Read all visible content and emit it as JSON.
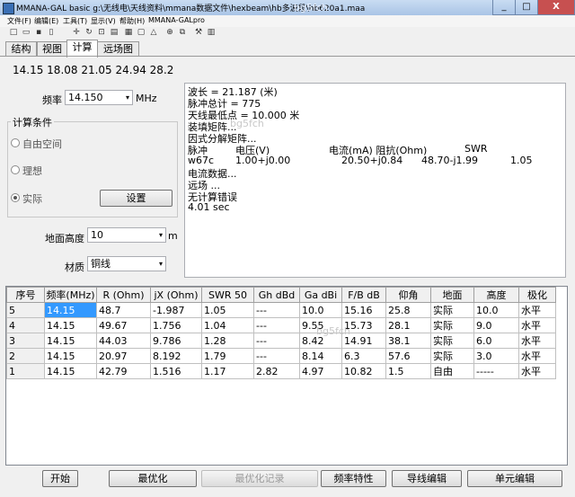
{
  "window": {
    "title": "MMANA-GAL basic g:\\无线电\\天线资料\\mmana数据文件\\hexbeam\\hb多波段\\hb620a1.maa",
    "watermark": "bg5fch",
    "min": "_",
    "max": "□",
    "close": "X"
  },
  "menu": [
    "文件(F)",
    "编辑(E)",
    "工具(T)",
    "显示(V)",
    "帮助(H)",
    "MMANA-GALpro"
  ],
  "tabs": [
    "结构",
    "视图",
    "计算",
    "远场图"
  ],
  "freq_list": "14.15  18.08  21.05 24.94   28.2",
  "freq": {
    "label": "频率",
    "value": "14.150",
    "unit": "MHz"
  },
  "conditions": {
    "title": "计算条件",
    "options": [
      "自由空间",
      "理想",
      "实际"
    ],
    "settings_button": "设置"
  },
  "height": {
    "label": "地面高度",
    "value": "10",
    "unit": "m"
  },
  "material": {
    "label": "材质",
    "value": "铜线"
  },
  "output": {
    "line1": "波长 = 21.187 (米)",
    "line2": "脉冲总计 = 775",
    "line3": "天线最低点 = 10.000 米",
    "line4": "装填矩阵...",
    "line5": "因式分解矩阵...",
    "hdr_pulse": "脉冲",
    "hdr_voltage": "电压(V)",
    "hdr_current": "电流(mA) 阻抗(Ohm)",
    "hdr_swr": "SWR",
    "row_pulse": "w67c",
    "row_voltage": "1.00+j0.00",
    "row_current": "20.50+j0.84",
    "row_impedance": "48.70-j1.99",
    "row_swr": "1.05",
    "line7": "电流数据...",
    "line8": "远场 ...",
    "line9": "无计算错误",
    "line10": "4.01 sec"
  },
  "table": {
    "headers": [
      "序号",
      "频率(MHz)",
      "R (Ohm)",
      "jX (Ohm)",
      "SWR 50",
      "Gh dBd",
      "Ga dBi",
      "F/B dB",
      "仰角",
      "地面",
      "高度",
      "极化"
    ],
    "rows": [
      [
        "5",
        "14.15",
        "48.7",
        "-1.987",
        "1.05",
        "---",
        "10.0",
        "15.16",
        "25.8",
        "实际",
        "10.0",
        "水平"
      ],
      [
        "4",
        "14.15",
        "49.67",
        "1.756",
        "1.04",
        "---",
        "9.55",
        "15.73",
        "28.1",
        "实际",
        "9.0",
        "水平"
      ],
      [
        "3",
        "14.15",
        "44.03",
        "9.786",
        "1.28",
        "---",
        "8.42",
        "14.91",
        "38.1",
        "实际",
        "6.0",
        "水平"
      ],
      [
        "2",
        "14.15",
        "20.97",
        "8.192",
        "1.79",
        "---",
        "8.14",
        "6.3",
        "57.6",
        "实际",
        "3.0",
        "水平"
      ],
      [
        "1",
        "14.15",
        "42.79",
        "1.516",
        "1.17",
        "2.82",
        "4.97",
        "10.82",
        "1.5",
        "自由",
        "-----",
        "水平"
      ]
    ]
  },
  "buttons": [
    "开始",
    "最优化",
    "最优化记录",
    "频率特性",
    "导线编辑",
    "单元编辑"
  ],
  "toolbar_icons": [
    "new-icon",
    "open-icon",
    "save-icon",
    "print-icon",
    "move-icon",
    "rotate-icon",
    "zoom-icon",
    "view-icon",
    "copy-icon",
    "paste-icon",
    "triangle-icon",
    "target-icon",
    "copy2-icon",
    "tools-icon",
    "calc-icon"
  ]
}
